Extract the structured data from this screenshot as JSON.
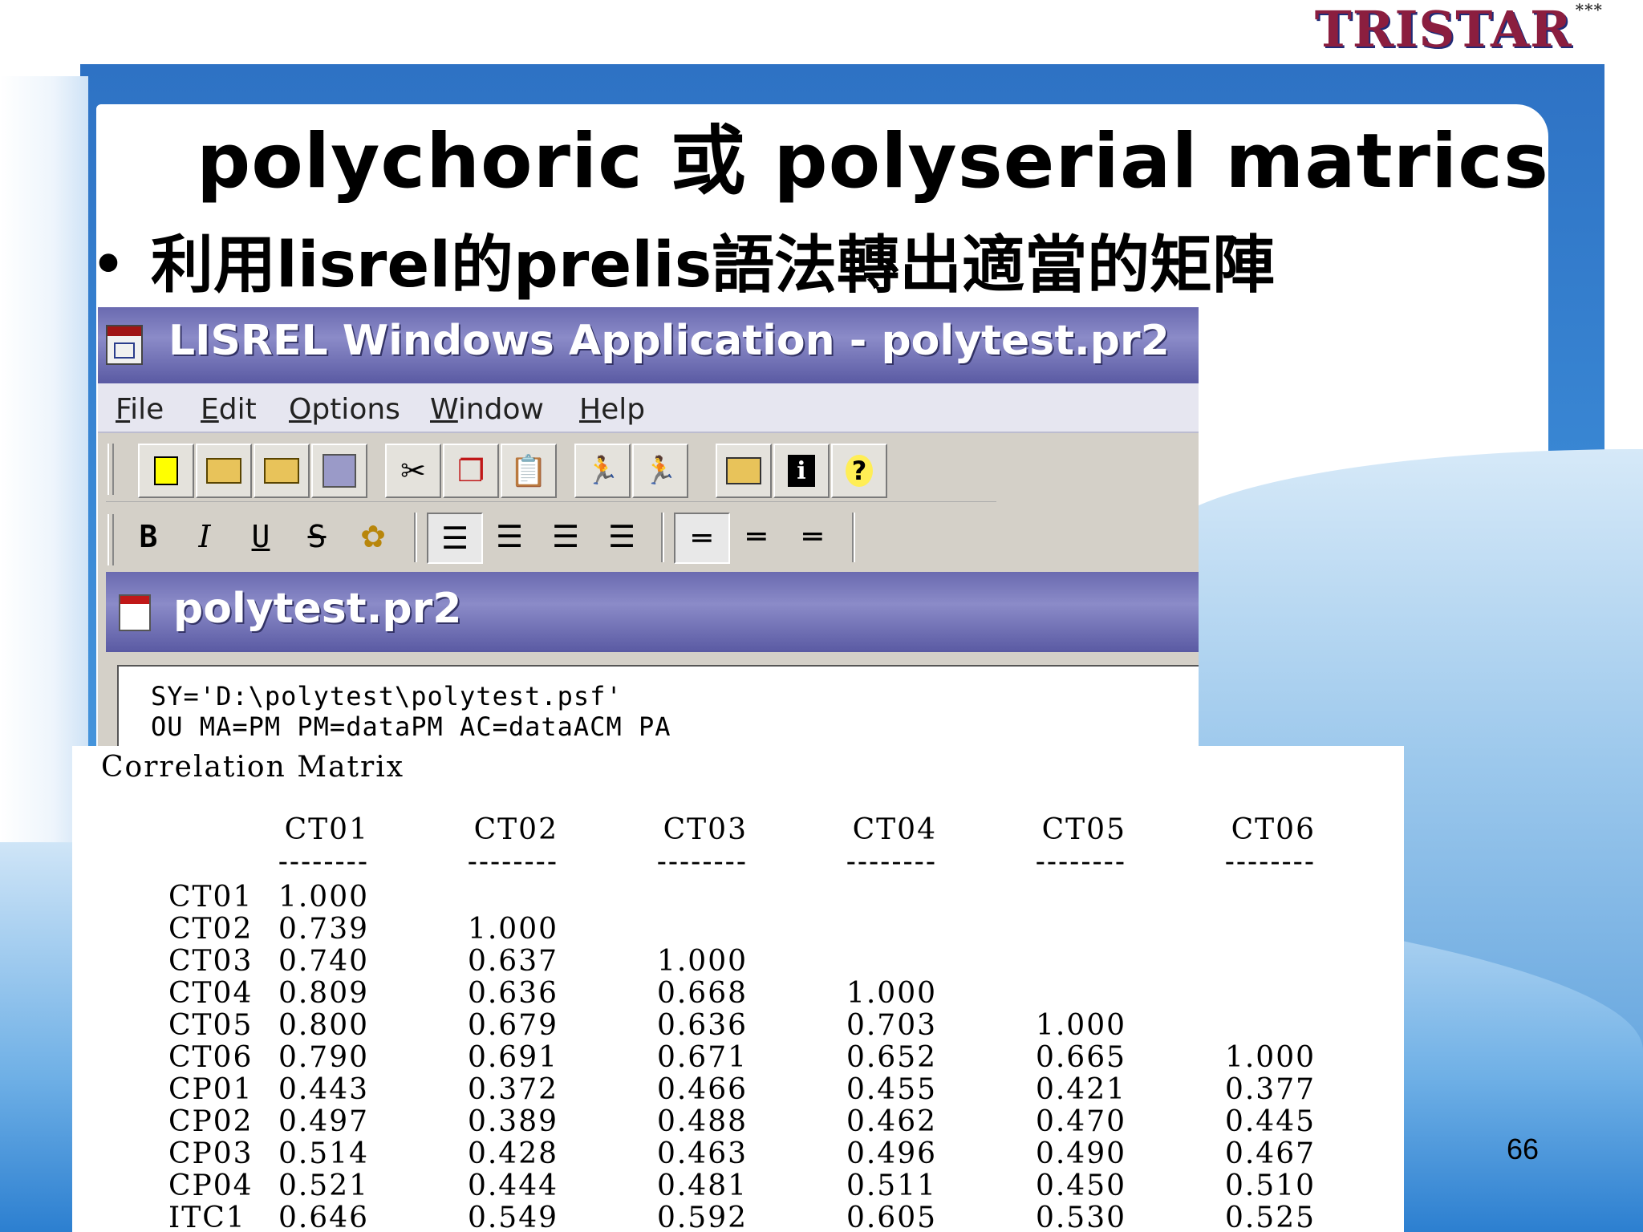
{
  "brand": {
    "logo": "TRISTAR",
    "stars": "***"
  },
  "slide": {
    "title": "polychoric  或  polyserial  matrics",
    "bullet": "利用lisrel的prelis語法轉出適當的矩陣",
    "page_number": "66"
  },
  "window": {
    "title": "LISREL Windows Application - polytest.pr2",
    "menu": [
      {
        "first": "F",
        "rest": "ile"
      },
      {
        "first": "E",
        "rest": "dit"
      },
      {
        "first": "O",
        "rest": "ptions"
      },
      {
        "first": "W",
        "rest": "indow"
      },
      {
        "first": "H",
        "rest": "elp"
      }
    ],
    "format_buttons": [
      "B",
      "I",
      "U",
      "S"
    ]
  },
  "document": {
    "title": "polytest.pr2",
    "lines": [
      "SY='D:\\polytest\\polytest.psf'",
      "OU MA=PM PM=dataPM AC=dataACM PA"
    ]
  },
  "matrix": {
    "title": "Correlation Matrix",
    "columns": [
      "CT01",
      "CT02",
      "CT03",
      "CT04",
      "CT05",
      "CT06"
    ],
    "dash": "--------",
    "rows": [
      {
        "label": "CT01",
        "values": [
          "1.000"
        ]
      },
      {
        "label": "CT02",
        "values": [
          "0.739",
          "1.000"
        ]
      },
      {
        "label": "CT03",
        "values": [
          "0.740",
          "0.637",
          "1.000"
        ]
      },
      {
        "label": "CT04",
        "values": [
          "0.809",
          "0.636",
          "0.668",
          "1.000"
        ]
      },
      {
        "label": "CT05",
        "values": [
          "0.800",
          "0.679",
          "0.636",
          "0.703",
          "1.000"
        ]
      },
      {
        "label": "CT06",
        "values": [
          "0.790",
          "0.691",
          "0.671",
          "0.652",
          "0.665",
          "1.000"
        ]
      },
      {
        "label": "CP01",
        "values": [
          "0.443",
          "0.372",
          "0.466",
          "0.455",
          "0.421",
          "0.377"
        ]
      },
      {
        "label": "CP02",
        "values": [
          "0.497",
          "0.389",
          "0.488",
          "0.462",
          "0.470",
          "0.445"
        ]
      },
      {
        "label": "CP03",
        "values": [
          "0.514",
          "0.428",
          "0.463",
          "0.496",
          "0.490",
          "0.467"
        ]
      },
      {
        "label": "CP04",
        "values": [
          "0.521",
          "0.444",
          "0.481",
          "0.511",
          "0.450",
          "0.510"
        ]
      },
      {
        "label": "ITC1",
        "values": [
          "0.646",
          "0.549",
          "0.592",
          "0.605",
          "0.530",
          "0.525"
        ]
      }
    ]
  }
}
